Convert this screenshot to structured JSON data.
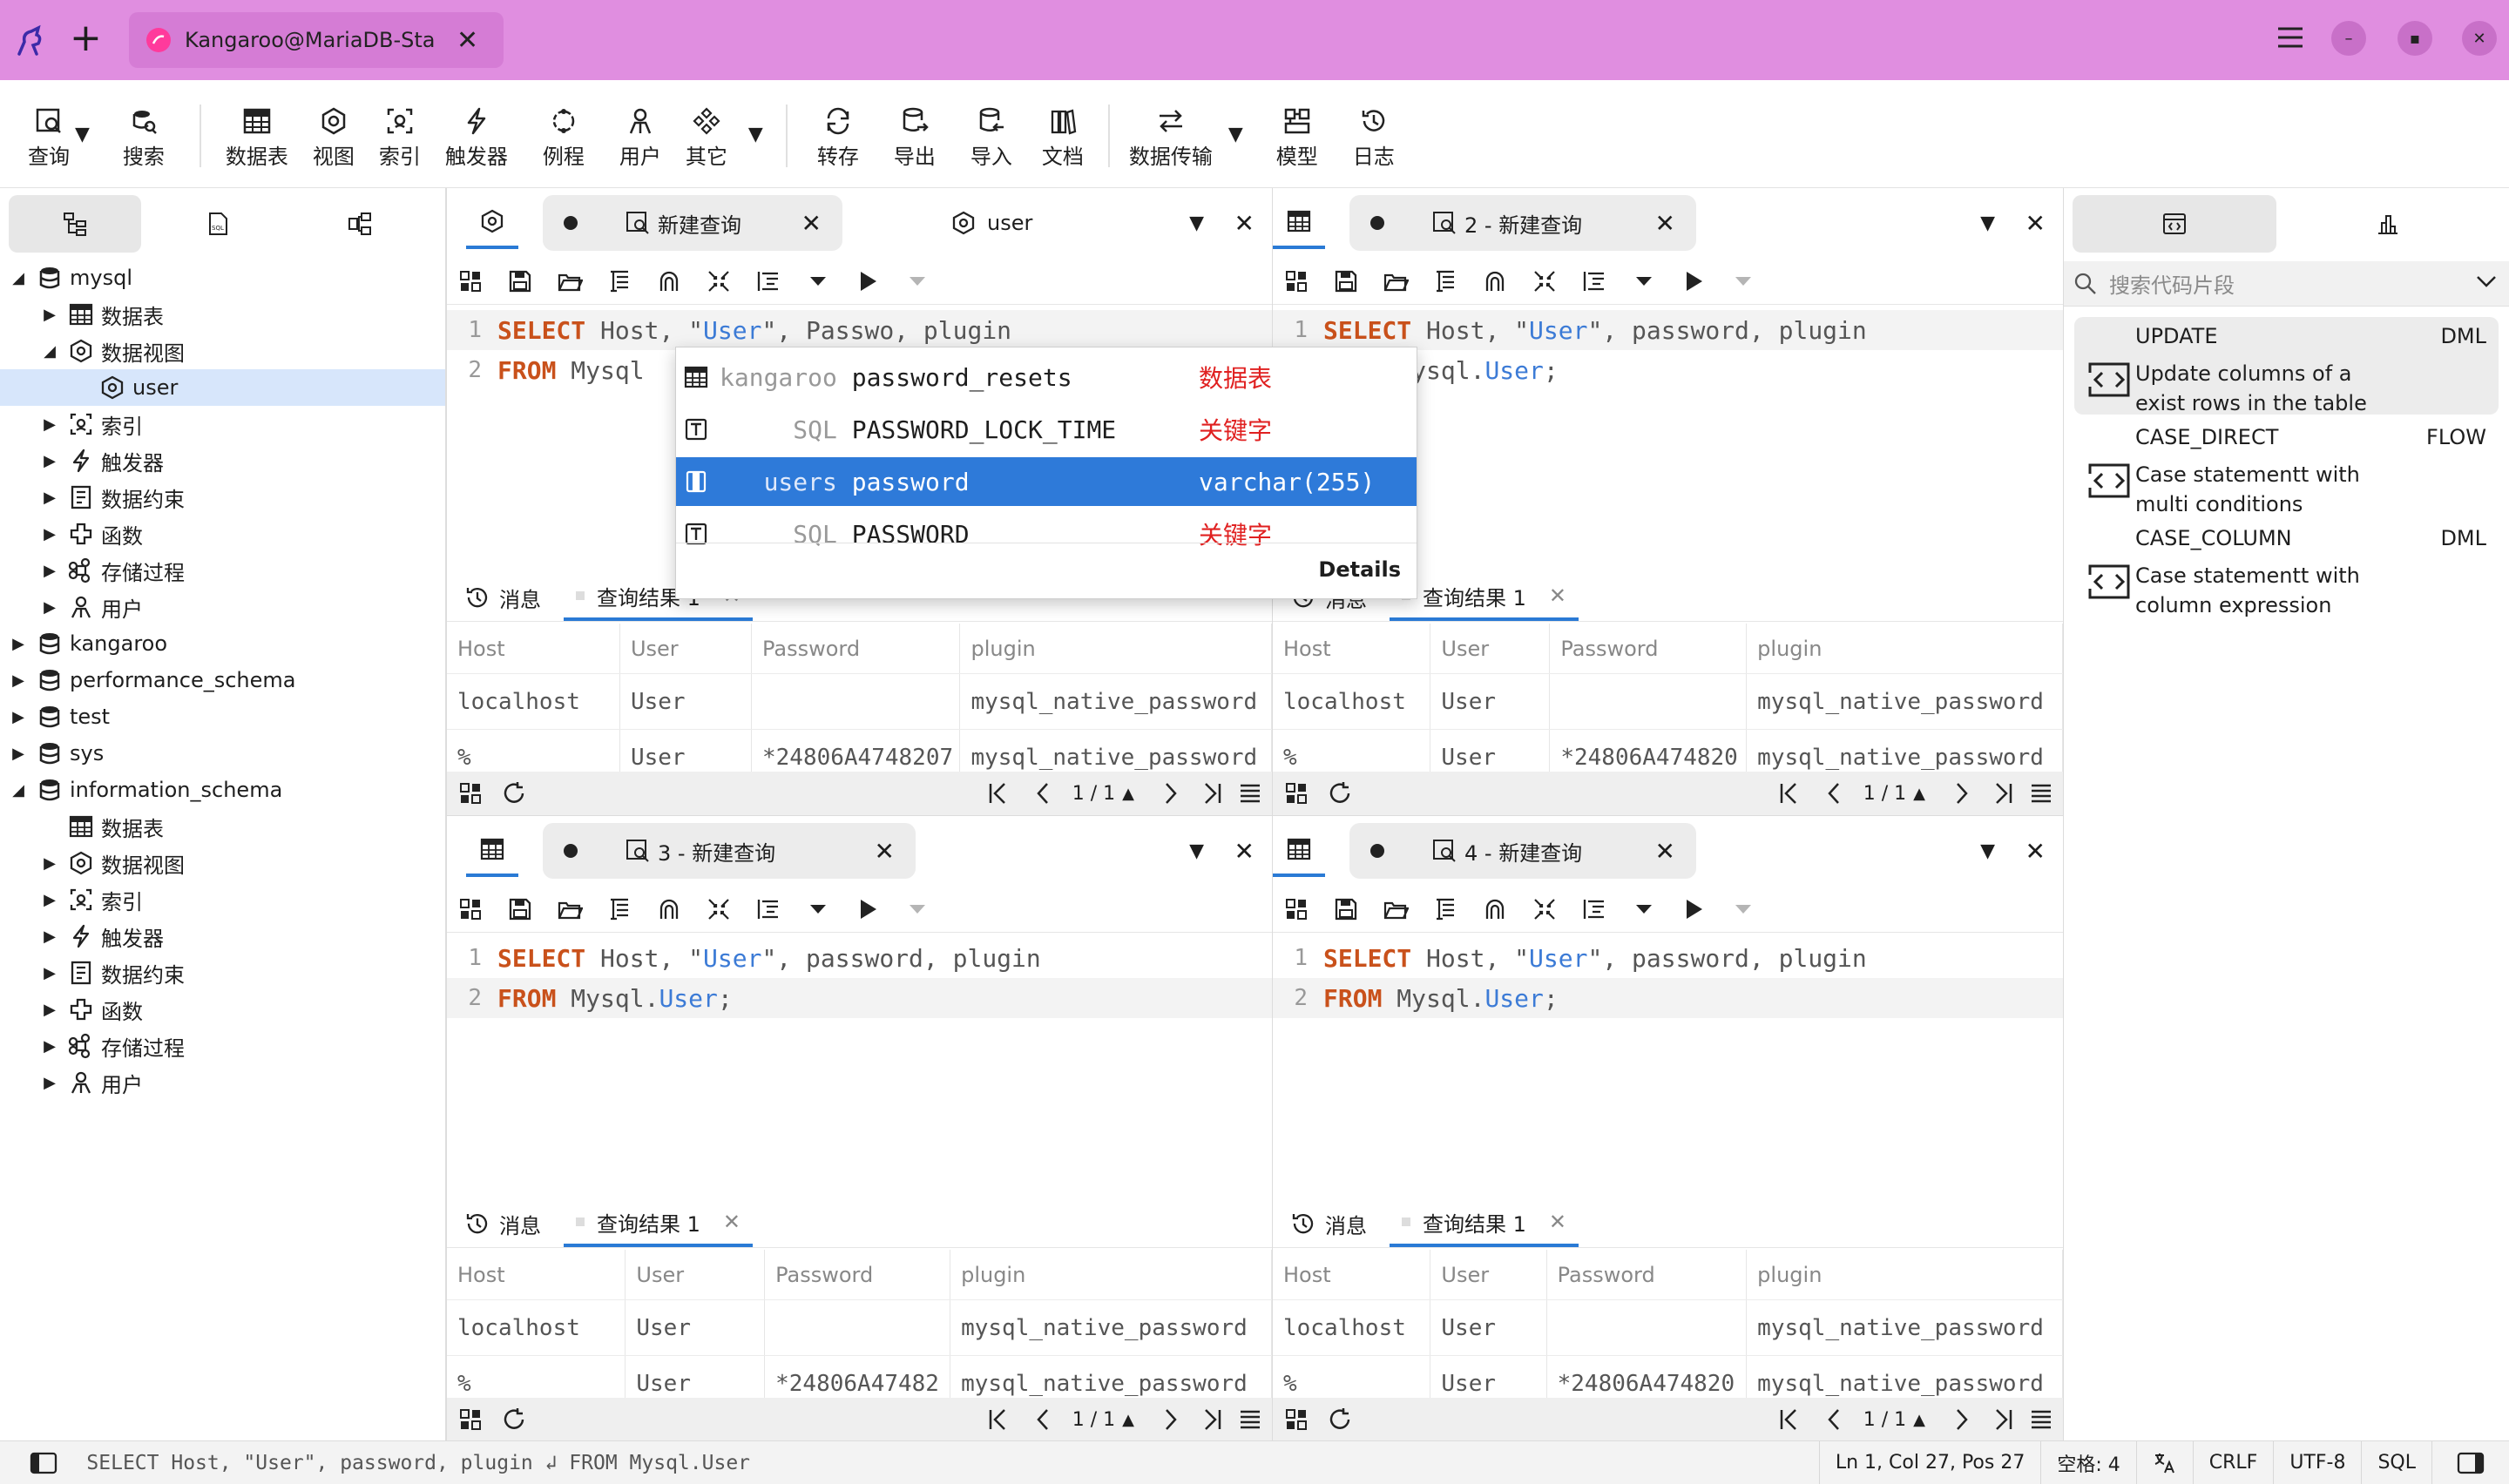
{
  "titlebar": {
    "tab_title": "Kangaroo@MariaDB-Sta"
  },
  "toolbar": {
    "items": [
      "查询",
      "搜索",
      "数据表",
      "视图",
      "索引",
      "触发器",
      "例程",
      "用户",
      "其它",
      "转存",
      "导出",
      "导入",
      "文档",
      "数据传输",
      "模型",
      "日志"
    ]
  },
  "sidebar": {
    "tree": [
      {
        "label": "mysql",
        "level": 0,
        "open": true,
        "icon": "database-icon"
      },
      {
        "label": "数据表",
        "level": 1,
        "open": false,
        "icon": "table-icon"
      },
      {
        "label": "数据视图",
        "level": 1,
        "open": true,
        "icon": "view-icon"
      },
      {
        "label": "user",
        "level": 2,
        "icon": "view-icon",
        "selected": true
      },
      {
        "label": "索引",
        "level": 1,
        "icon": "index-icon"
      },
      {
        "label": "触发器",
        "level": 1,
        "icon": "trigger-icon"
      },
      {
        "label": "数据约束",
        "level": 1,
        "icon": "constraint-icon"
      },
      {
        "label": "函数",
        "level": 1,
        "icon": "function-icon"
      },
      {
        "label": "存储过程",
        "level": 1,
        "icon": "procedure-icon"
      },
      {
        "label": "用户",
        "level": 1,
        "icon": "user-icon"
      },
      {
        "label": "kangaroo",
        "level": 0,
        "icon": "database-icon"
      },
      {
        "label": "performance_schema",
        "level": 0,
        "icon": "database-icon"
      },
      {
        "label": "test",
        "level": 0,
        "icon": "database-icon"
      },
      {
        "label": "sys",
        "level": 0,
        "icon": "database-icon"
      },
      {
        "label": "information_schema",
        "level": 0,
        "open": true,
        "icon": "database-icon"
      },
      {
        "label": "数据表",
        "level": 1,
        "icon": "table-icon",
        "noarrow": true
      },
      {
        "label": "数据视图",
        "level": 1,
        "icon": "view-icon"
      },
      {
        "label": "索引",
        "level": 1,
        "icon": "index-icon"
      },
      {
        "label": "触发器",
        "level": 1,
        "icon": "trigger-icon"
      },
      {
        "label": "数据约束",
        "level": 1,
        "icon": "constraint-icon"
      },
      {
        "label": "函数",
        "level": 1,
        "icon": "function-icon"
      },
      {
        "label": "存储过程",
        "level": 1,
        "icon": "procedure-icon"
      },
      {
        "label": "用户",
        "level": 1,
        "icon": "user-icon"
      }
    ]
  },
  "panes": {
    "p1": {
      "tab": "新建查询",
      "tab2": "user",
      "code1_pre": "SELECT",
      "code1": " Host, \"",
      "code1_str": "User",
      "code1_post": "\", Passwo, plugin",
      "code2": "FROM",
      "code2_rest": " Mysql"
    },
    "p2": {
      "tab": "2 - 新建查询",
      "code1": " Host, \"",
      "code1_str": "User",
      "code1_post": "\", password, plugin",
      "code2_rest": " Mysql.",
      "code2_str": "User"
    },
    "p3": {
      "tab": "3 - 新建查询"
    },
    "p4": {
      "tab": "4 - 新建查询"
    },
    "kw_select": "SELECT",
    "kw_from": "FROM",
    "sql_mid": " Host, \"",
    "sql_user": "User",
    "sql_tail": "\", password, plugin",
    "from_mid": " Mysql.",
    "semicolon": ";"
  },
  "results": {
    "messages": "消息",
    "result_tab": "查询结果 1",
    "headers": [
      "Host",
      "User",
      "Password",
      "plugin"
    ],
    "rows": [
      [
        "localhost",
        "User",
        "",
        "mysql_native_password"
      ],
      [
        "%",
        "User",
        "*24806A4748207",
        "mysql_native_password"
      ]
    ],
    "row2_pw_b": "*24806A474820",
    "row2_pw_c": "*24806A47482",
    "page": "1 / 1"
  },
  "autocomplete": {
    "items": [
      {
        "icon": "table-icon",
        "prefix": "kangaroo ",
        "name": "password_resets",
        "kind": "数据表"
      },
      {
        "icon": "text-icon",
        "prefix": "     SQL ",
        "name": "PASSWORD_LOCK_TIME",
        "kind": "关键字"
      },
      {
        "icon": "column-icon",
        "prefix": "   users ",
        "name": "password",
        "kind": "varchar(255)"
      },
      {
        "icon": "text-icon",
        "prefix": "     SQL ",
        "name": "PASSWORD",
        "kind": "关键字"
      }
    ],
    "details": "Details"
  },
  "snippets": {
    "search_placeholder": "搜索代码片段",
    "items": [
      {
        "name": "UPDATE",
        "tag": "DML",
        "desc": "Update columns of a exist rows in the table"
      },
      {
        "name": "CASE_DIRECT",
        "tag": "FLOW",
        "desc": "Case statementt with multi conditions"
      },
      {
        "name": "CASE_COLUMN",
        "tag": "DML",
        "desc": "Case statementt with column expression"
      }
    ]
  },
  "status": {
    "sql": "SELECT Host, \"User\", password, plugin ↲ FROM Mysql.User",
    "position": "Ln 1, Col 27, Pos 27",
    "spaces": "空格: 4",
    "eol": "CRLF",
    "encoding": "UTF-8",
    "lang": "SQL"
  },
  "colors": {
    "titlebar": "#e08ee0",
    "accent": "#2e7ad9",
    "keyword": "#c9511b",
    "string": "#3c7bd6"
  }
}
